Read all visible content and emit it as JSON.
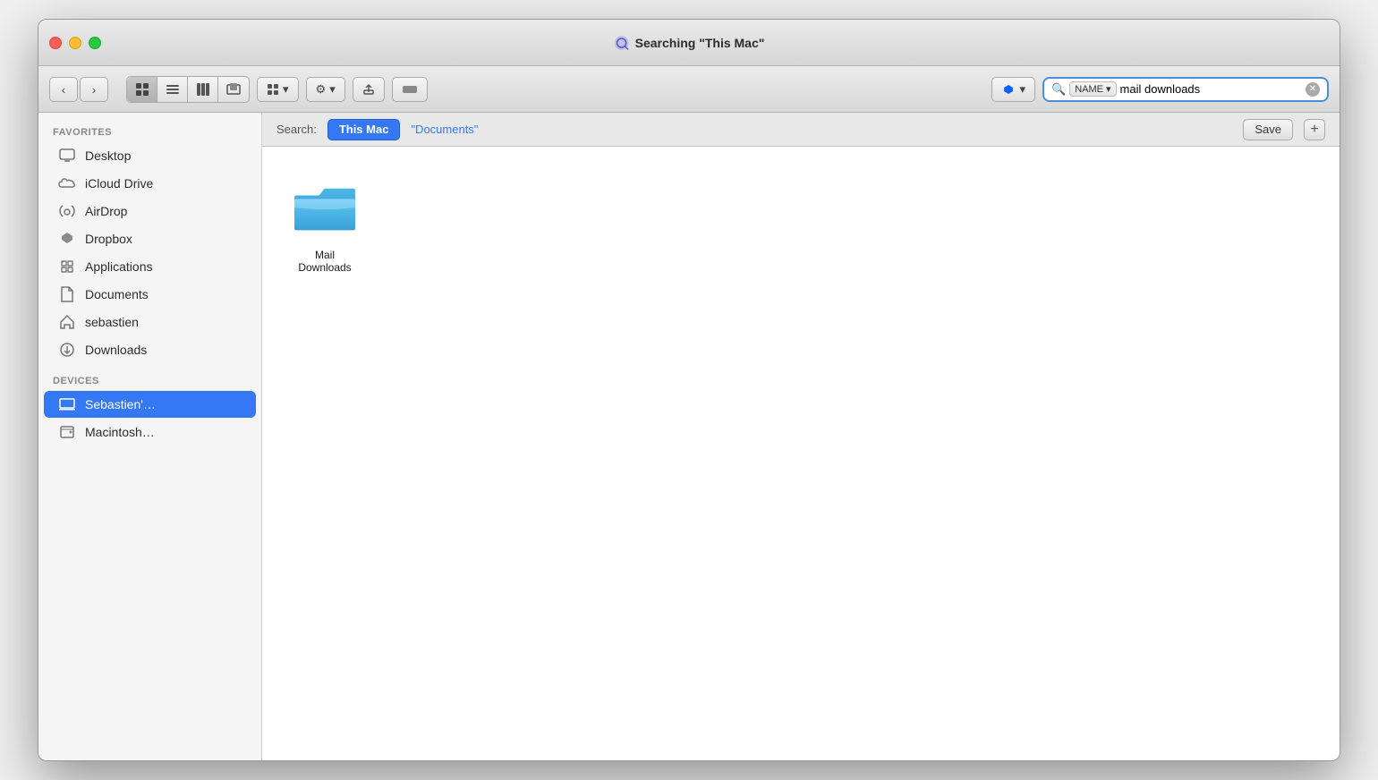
{
  "window": {
    "title": "Searching \"This Mac\""
  },
  "toolbar": {
    "back_label": "‹",
    "forward_label": "›",
    "view_icon_grid": "⊞",
    "view_icon_list": "≡",
    "view_icon_column": "|||",
    "view_icon_cover": "⊟",
    "view_group_label": "⊞ ▾",
    "settings_label": "⚙ ▾",
    "share_label": "↑",
    "tag_label": "⬛",
    "dropbox_label": "💧 ▾",
    "search_icon": "🔍",
    "search_name_label": "NAME ▾",
    "search_value": "mail downloads",
    "search_clear": "✕"
  },
  "scope_bar": {
    "search_label": "Search:",
    "this_mac_label": "This Mac",
    "documents_label": "\"Documents\"",
    "save_label": "Save",
    "add_label": "+"
  },
  "sidebar": {
    "favorites_label": "Favorites",
    "devices_label": "Devices",
    "items": [
      {
        "id": "desktop",
        "label": "Desktop",
        "icon": "desktop"
      },
      {
        "id": "icloud",
        "label": "iCloud Drive",
        "icon": "cloud"
      },
      {
        "id": "airdrop",
        "label": "AirDrop",
        "icon": "airdrop"
      },
      {
        "id": "dropbox",
        "label": "Dropbox",
        "icon": "dropbox"
      },
      {
        "id": "applications",
        "label": "Applications",
        "icon": "applications"
      },
      {
        "id": "documents",
        "label": "Documents",
        "icon": "documents"
      },
      {
        "id": "sebastien",
        "label": "sebastien",
        "icon": "home"
      },
      {
        "id": "downloads",
        "label": "Downloads",
        "icon": "downloads"
      }
    ],
    "device_items": [
      {
        "id": "sebastien-mac",
        "label": "Sebastien'…",
        "icon": "laptop",
        "active": true
      },
      {
        "id": "macintosh",
        "label": "Macintosh…",
        "icon": "hdd"
      }
    ]
  },
  "files": [
    {
      "id": "mail-downloads",
      "label": "Mail Downloads",
      "type": "folder"
    }
  ]
}
